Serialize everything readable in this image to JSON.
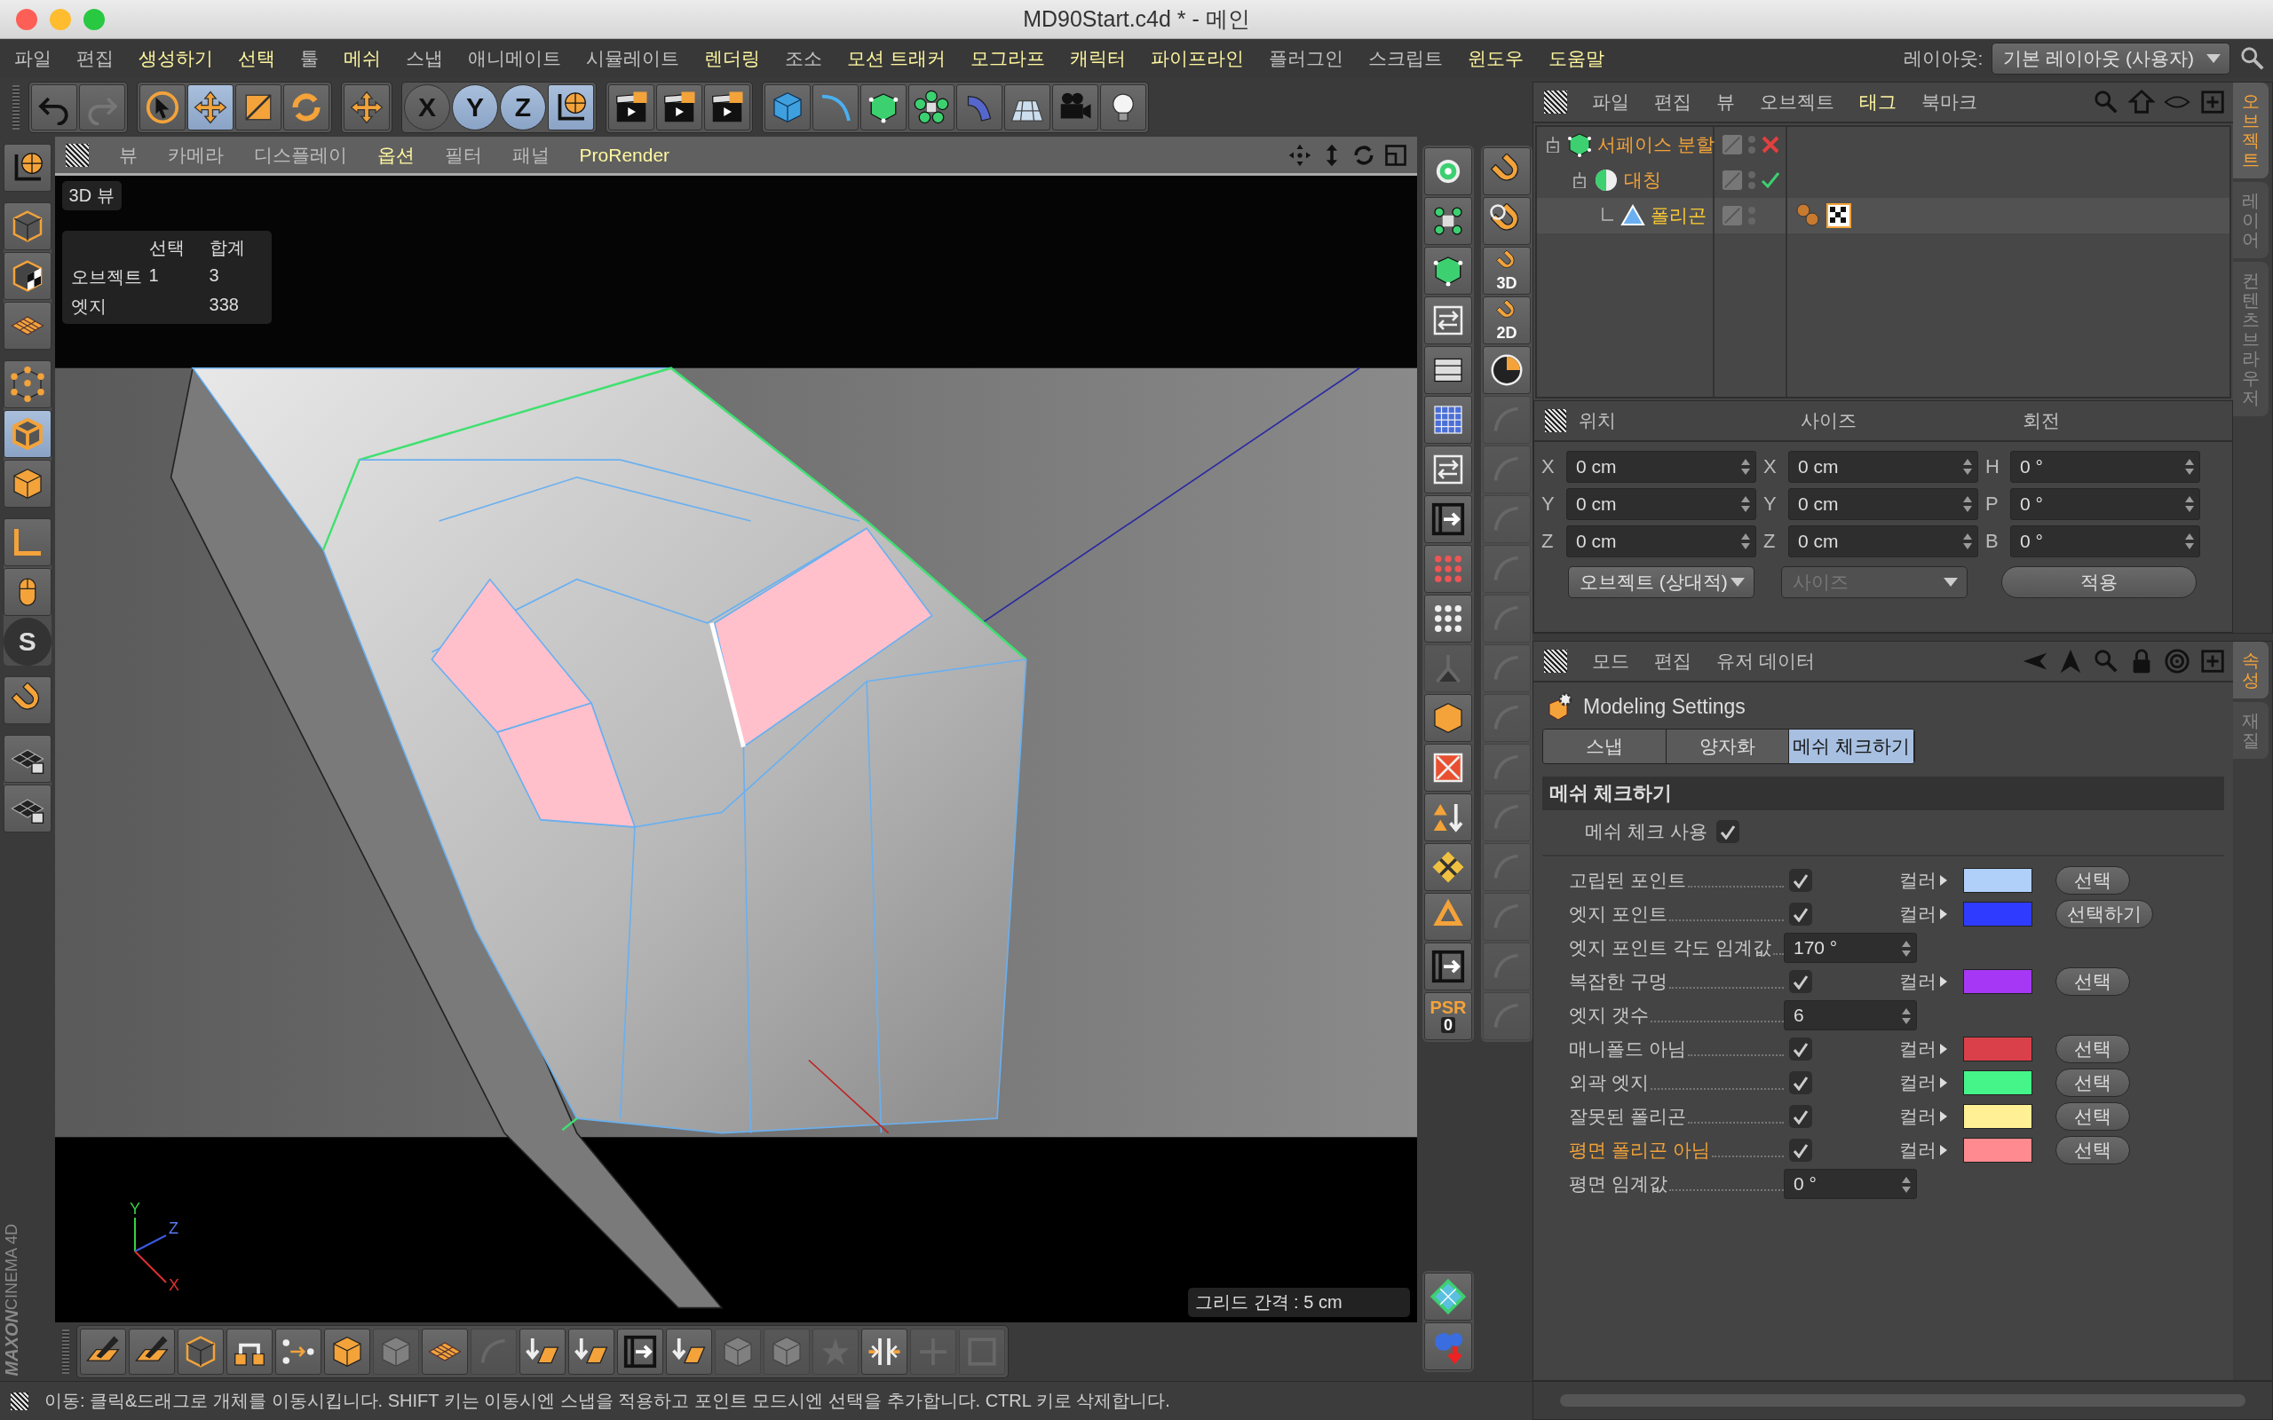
{
  "window": {
    "title": "MD90Start.c4d * - 메인"
  },
  "menu": [
    {
      "label": "파일",
      "highlighted": false
    },
    {
      "label": "편집",
      "highlighted": false
    },
    {
      "label": "생성하기",
      "highlighted": true
    },
    {
      "label": "선택",
      "highlighted": true
    },
    {
      "label": "툴",
      "highlighted": false
    },
    {
      "label": "메쉬",
      "highlighted": true
    },
    {
      "label": "스냅",
      "highlighted": false
    },
    {
      "label": "애니메이트",
      "highlighted": false
    },
    {
      "label": "시뮬레이트",
      "highlighted": false
    },
    {
      "label": "렌더링",
      "highlighted": true
    },
    {
      "label": "조소",
      "highlighted": false
    },
    {
      "label": "모션 트래커",
      "highlighted": true
    },
    {
      "label": "모그라프",
      "highlighted": true
    },
    {
      "label": "캐릭터",
      "highlighted": true
    },
    {
      "label": "파이프라인",
      "highlighted": true
    },
    {
      "label": "플러그인",
      "highlighted": false
    },
    {
      "label": "스크립트",
      "highlighted": false
    },
    {
      "label": "윈도우",
      "highlighted": true
    },
    {
      "label": "도움말",
      "highlighted": true
    }
  ],
  "layout": {
    "label": "레이아웃:",
    "value": "기본 레이아웃 (사용자)"
  },
  "toolbar": [
    {
      "buttons": [
        {
          "selected": false
        },
        {
          "selected": false
        }
      ]
    },
    {
      "buttons": [
        {
          "selected": false
        },
        {
          "selected": true
        },
        {
          "selected": false
        },
        {
          "selected": false
        }
      ]
    },
    {
      "buttons": [
        {
          "selected": false
        }
      ]
    },
    {
      "buttons": [
        {
          "label": "X",
          "selected": false
        },
        {
          "label": "Y",
          "selected": true
        },
        {
          "label": "Z",
          "selected": true
        },
        {
          "selected": true
        }
      ]
    },
    {
      "buttons": [
        {
          "selected": false
        },
        {
          "selected": false
        },
        {
          "selected": false
        }
      ]
    },
    {
      "buttons": [
        {
          "selected": false
        },
        {
          "selected": false
        },
        {
          "selected": false
        },
        {
          "selected": false
        },
        {
          "selected": false
        },
        {
          "selected": false
        },
        {
          "selected": false
        },
        {
          "selected": false
        }
      ]
    }
  ],
  "left_toolbar": [
    {
      "buttons": [
        {
          "selected": false
        }
      ]
    },
    {
      "buttons": [
        {
          "selected": false
        },
        {
          "selected": false
        },
        {
          "selected": false
        }
      ]
    },
    {
      "buttons": [
        {
          "selected": false
        },
        {
          "selected": true
        },
        {
          "selected": false
        }
      ]
    },
    {
      "buttons": [
        {
          "selected": false
        },
        {
          "selected": false
        },
        {
          "label": "S",
          "selected": false
        }
      ]
    },
    {
      "buttons": [
        {
          "selected": false
        }
      ]
    },
    {
      "buttons": [
        {
          "selected": false
        },
        {
          "selected": false
        }
      ]
    }
  ],
  "logo": [
    "MAXON",
    "CINEMA 4D"
  ],
  "viewport": {
    "menu": [
      {
        "label": "뷰",
        "highlighted": false
      },
      {
        "label": "카메라",
        "highlighted": false
      },
      {
        "label": "디스플레이",
        "highlighted": false
      },
      {
        "label": "옵션",
        "highlighted": true
      },
      {
        "label": "필터",
        "highlighted": false
      },
      {
        "label": "패널",
        "highlighted": false
      },
      {
        "label": "ProRender",
        "highlighted": true
      }
    ],
    "view_label": "3D 뷰",
    "stats": {
      "headers": [
        "선택",
        "합계"
      ],
      "rows": [
        {
          "label": "오브젝트",
          "selected_count": "1",
          "total": "3"
        },
        {
          "label": "엣지",
          "total": "338"
        }
      ]
    },
    "axes": [
      "Y",
      "Z",
      "X"
    ],
    "grid_label": "그리드 간격 : 5 cm"
  },
  "bottom_toolbar": [
    {
      "disabled": false
    },
    {
      "disabled": false
    },
    {
      "disabled": false
    },
    {
      "disabled": false
    },
    {
      "disabled": false
    },
    {
      "disabled": false
    },
    {
      "disabled": true
    },
    {
      "disabled": false
    },
    {
      "disabled": true
    },
    {
      "disabled": false
    },
    {
      "disabled": false
    },
    {
      "disabled": false
    },
    {
      "disabled": false
    },
    {
      "disabled": true
    },
    {
      "disabled": true
    },
    {
      "disabled": true
    },
    {
      "disabled": false
    },
    {
      "disabled": true
    },
    {
      "disabled": true
    }
  ],
  "mid_toolbar": [
    {
      "disabled": false
    },
    {
      "disabled": false
    },
    {
      "disabled": false
    },
    {
      "disabled": false
    },
    {
      "disabled": false
    },
    {
      "disabled": false
    },
    {
      "disabled": false
    },
    {
      "disabled": false
    },
    {
      "disabled": false
    },
    {
      "disabled": false
    },
    {
      "disabled": true
    },
    {
      "disabled": false
    },
    {
      "disabled": false
    },
    {
      "disabled": false
    },
    {
      "disabled": false
    },
    {
      "disabled": false
    },
    {
      "disabled": false
    },
    {
      "label": "PSR",
      "sub": "0",
      "disabled": false
    }
  ],
  "mid_toolbar_2": [
    {
      "disabled": false
    },
    {
      "disabled": false
    },
    {
      "label": "3D",
      "disabled": false
    },
    {
      "label": "2D",
      "disabled": false
    },
    {
      "disabled": false
    },
    {
      "disabled": true
    },
    {
      "disabled": true
    },
    {
      "disabled": true
    },
    {
      "disabled": true
    },
    {
      "disabled": true
    },
    {
      "disabled": true
    },
    {
      "disabled": true
    },
    {
      "disabled": true
    },
    {
      "disabled": true
    },
    {
      "disabled": true
    },
    {
      "disabled": true
    },
    {
      "disabled": true
    },
    {
      "disabled": true
    }
  ],
  "mid_toolbar_bottom": [
    {
      "disabled": false
    },
    {
      "disabled": false
    }
  ],
  "object_manager": {
    "menu": [
      {
        "label": "파일",
        "highlighted": false
      },
      {
        "label": "편집",
        "highlighted": false
      },
      {
        "label": "뷰",
        "highlighted": false
      },
      {
        "label": "오브젝트",
        "highlighted": false
      },
      {
        "label": "태그",
        "highlighted": true
      },
      {
        "label": "북마크",
        "highlighted": false
      }
    ],
    "tree": [
      {
        "name": "서페이스 분할",
        "kind": "subdivision",
        "enabled": false,
        "selected": false,
        "children": [
          {
            "name": "대칭",
            "kind": "symmetry",
            "enabled": true,
            "selected": false,
            "children": [
              {
                "name": "폴리곤",
                "kind": "polygon",
                "selected": true,
                "tags": [
                  {
                    "kind": "phong"
                  },
                  {
                    "kind": "material"
                  }
                ]
              }
            ]
          }
        ]
      }
    ]
  },
  "side_tabs": [
    {
      "label": "오브젝트",
      "selected": true
    },
    {
      "label": "레이어",
      "selected": false
    },
    {
      "label": "컨텐츠 브라우저",
      "selected": false
    }
  ],
  "coordinates": {
    "headers": [
      "위치",
      "사이즈",
      "회전"
    ],
    "rows": [
      [
        {
          "axis": "X",
          "value": "0 cm"
        },
        {
          "axis": "X",
          "value": "0 cm"
        },
        {
          "axis": "H",
          "value": "0 °"
        }
      ],
      [
        {
          "axis": "Y",
          "value": "0 cm"
        },
        {
          "axis": "Y",
          "value": "0 cm"
        },
        {
          "axis": "P",
          "value": "0 °"
        }
      ],
      [
        {
          "axis": "Z",
          "value": "0 cm"
        },
        {
          "axis": "Z",
          "value": "0 cm"
        },
        {
          "axis": "B",
          "value": "0 °"
        }
      ]
    ],
    "dropdowns": [
      {
        "value": "오브젝트 (상대적)",
        "disabled": false
      },
      {
        "value": "사이즈",
        "disabled": true
      }
    ],
    "apply": "적용"
  },
  "attributes": {
    "menu": [
      "모드",
      "편집",
      "유저 데이터"
    ],
    "title": "Modeling Settings",
    "tabs": [
      {
        "label": "스냅",
        "selected": false
      },
      {
        "label": "양자화",
        "selected": false
      },
      {
        "label": "메쉬 체크하기",
        "selected": true
      }
    ],
    "section": "메쉬 체크하기",
    "enable": {
      "label": "메쉬 체크 사용",
      "checked": true
    },
    "rows": [
      {
        "kind": "check",
        "label": "고립된 포인트",
        "checked": true,
        "highlighted": false,
        "color_label": "컬러",
        "color": "#b0d0fa",
        "button": "선택"
      },
      {
        "kind": "check",
        "label": "엣지 포인트",
        "checked": true,
        "highlighted": false,
        "color_label": "컬러",
        "color": "#2f3cff",
        "button": "선택하기"
      },
      {
        "kind": "number",
        "label": "엣지 포인트 각도 임계값",
        "value": "170 °"
      },
      {
        "kind": "check",
        "label": "복잡한 구멍",
        "checked": true,
        "highlighted": false,
        "color_label": "컬러",
        "color": "#a638f5",
        "button": "선택"
      },
      {
        "kind": "number",
        "label": "엣지 갯수",
        "value": "6"
      },
      {
        "kind": "check",
        "label": "매니폴드 아님",
        "checked": true,
        "highlighted": false,
        "color_label": "컬러",
        "color": "#d9404a",
        "button": "선택"
      },
      {
        "kind": "check",
        "label": "외곽 엣지",
        "checked": true,
        "highlighted": false,
        "color_label": "컬러",
        "color": "#45f58a",
        "button": "선택"
      },
      {
        "kind": "check",
        "label": "잘못된 폴리곤",
        "checked": true,
        "highlighted": false,
        "color_label": "컬러",
        "color": "#fff096",
        "button": "선택"
      },
      {
        "kind": "check",
        "label": "평면 폴리곤 아님",
        "checked": true,
        "highlighted": true,
        "color_label": "컬러",
        "color": "#ff8a8f",
        "button": "선택"
      },
      {
        "kind": "number",
        "label": "평면 임계값",
        "value": "0 °"
      }
    ]
  },
  "attribute_tabs": [
    {
      "label": "속성",
      "selected": true
    },
    {
      "label": "재질",
      "selected": false
    }
  ],
  "status_bar": "이동: 클릭&드래그로 개체를 이동시킵니다. SHIFT 키는 이동시엔 스냅을 적용하고 포인트 모드시엔 선택을 추가합니다. CTRL 키로 삭제합니다."
}
